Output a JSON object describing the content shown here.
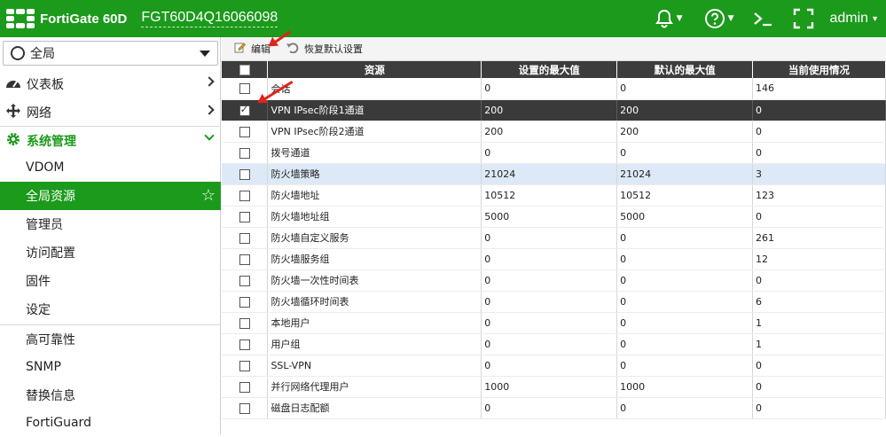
{
  "header": {
    "brand": "FortiGate 60D",
    "serial": "FGT60D4Q16066098",
    "user": "admin"
  },
  "sidebar": {
    "scope": "全局",
    "nav": [
      {
        "label": "仪表板",
        "icon": "dashboard-icon"
      },
      {
        "label": "网络",
        "icon": "network-icon"
      },
      {
        "label": "系统管理",
        "icon": "gear-icon"
      }
    ],
    "sub_items": [
      "VDOM",
      "全局资源",
      "管理员",
      "访问配置",
      "固件",
      "设定"
    ],
    "sub_items_2": [
      "高可靠性",
      "SNMP",
      "替换信息",
      "FortiGuard"
    ]
  },
  "toolbar": {
    "edit": "编辑",
    "reset": "恢复默认设置"
  },
  "table": {
    "headers": [
      "资源",
      "设置的最大值",
      "默认的最大值",
      "当前使用情况"
    ],
    "rows": [
      {
        "res": "会话",
        "set": "0",
        "def": "0",
        "cur": "146"
      },
      {
        "res": "VPN IPsec阶段1通道",
        "set": "200",
        "def": "200",
        "cur": "0"
      },
      {
        "res": "VPN IPsec阶段2通道",
        "set": "200",
        "def": "200",
        "cur": "0"
      },
      {
        "res": "拨号通道",
        "set": "0",
        "def": "0",
        "cur": "0"
      },
      {
        "res": "防火墙策略",
        "set": "21024",
        "def": "21024",
        "cur": "3"
      },
      {
        "res": "防火墙地址",
        "set": "10512",
        "def": "10512",
        "cur": "123"
      },
      {
        "res": "防火墙地址组",
        "set": "5000",
        "def": "5000",
        "cur": "0"
      },
      {
        "res": "防火墙自定义服务",
        "set": "0",
        "def": "0",
        "cur": "261"
      },
      {
        "res": "防火墙服务组",
        "set": "0",
        "def": "0",
        "cur": "12"
      },
      {
        "res": "防火墙一次性时间表",
        "set": "0",
        "def": "0",
        "cur": "0"
      },
      {
        "res": "防火墙循环时间表",
        "set": "0",
        "def": "0",
        "cur": "6"
      },
      {
        "res": "本地用户",
        "set": "0",
        "def": "0",
        "cur": "1"
      },
      {
        "res": "用户组",
        "set": "0",
        "def": "0",
        "cur": "1"
      },
      {
        "res": "SSL-VPN",
        "set": "0",
        "def": "0",
        "cur": "0"
      },
      {
        "res": "并行网络代理用户",
        "set": "1000",
        "def": "1000",
        "cur": "0"
      },
      {
        "res": "磁盘日志配额",
        "set": "0",
        "def": "0",
        "cur": "0"
      }
    ]
  },
  "colors": {
    "brand_green": "#1b9a1b",
    "header_dark": "#3d3d3d",
    "annotation_red": "#e0241b"
  }
}
